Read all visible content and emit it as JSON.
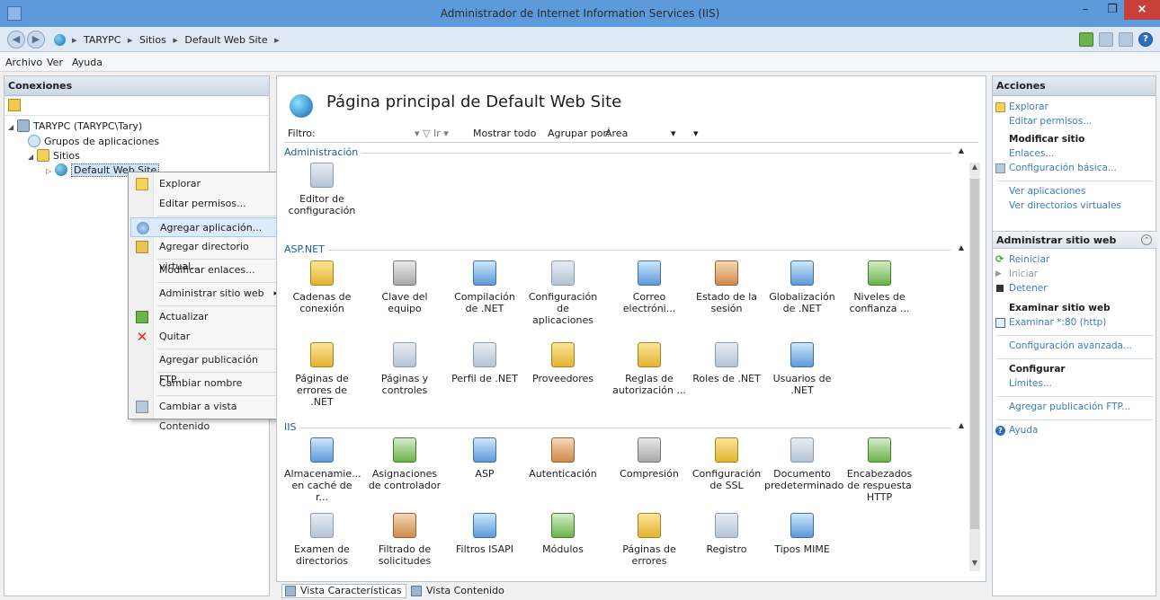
{
  "window": {
    "title": "Administrador de Internet Information Services (IIS)",
    "min": "–",
    "max": "❐",
    "close": "×"
  },
  "address": {
    "back": "◀",
    "forward": "▶",
    "crumbs": [
      "TARYPC",
      "Sitios",
      "Default Web Site"
    ],
    "sep": "▸"
  },
  "menu": [
    "Archivo",
    "Ver",
    "Ayuda"
  ],
  "connections": {
    "title": "Conexiones",
    "tree": [
      {
        "label": "TARYPC (TARYPC\\Tary)",
        "arrow": "◢"
      },
      {
        "label": "Grupos de aplicaciones",
        "arrow": ""
      },
      {
        "label": "Sitios",
        "arrow": "◢"
      },
      {
        "label": "Default Web Site",
        "arrow": "▷"
      }
    ]
  },
  "context_menu": {
    "items": [
      "Explorar",
      "Editar permisos...",
      "Agregar aplicación...",
      "Agregar directorio virtual...",
      "Modificar enlaces...",
      "Administrar sitio web",
      "Actualizar",
      "Quitar",
      "Agregar publicación FTP...",
      "Cambiar nombre",
      "Cambiar a vista Contenido"
    ],
    "submenu_arrow": "▸",
    "remove_glyph": "✕"
  },
  "main": {
    "title": "Página principal de Default Web Site",
    "filter_label": "Filtro:",
    "go_label": "▾ ▽ Ir ▾",
    "show_all": "Mostrar todo",
    "group_by_label": "Agrupar por:",
    "group_by_value": "Área",
    "dropdown_arrow": "▾",
    "collapse_glyph": "▲",
    "groups": [
      {
        "title": "Administración",
        "items": [
          "Editor de configuración"
        ]
      },
      {
        "title": "ASP.NET",
        "items": [
          "Cadenas de conexión",
          "Clave del equipo",
          "Compilación de .NET",
          "Configuración de aplicaciones",
          "Correo electróni...",
          "Estado de la sesión",
          "Globalización de .NET",
          "Niveles de confianza ...",
          "Páginas de errores de .NET",
          "Páginas y controles",
          "Perfil de .NET",
          "Proveedores",
          "Reglas de autorización ...",
          "Roles de .NET",
          "Usuarios de .NET"
        ]
      },
      {
        "title": "IIS",
        "items": [
          "Almacenamie... en caché de r...",
          "Asignaciones de controlador",
          "ASP",
          "Autenticación",
          "Compresión",
          "Configuración de SSL",
          "Documento predeterminado",
          "Encabezados de respuesta HTTP",
          "Examen de directorios",
          "Filtrado de solicitudes",
          "Filtros ISAPI",
          "Módulos",
          "Páginas de errores",
          "Registro",
          "Tipos MIME"
        ]
      }
    ],
    "tabs": [
      "Vista Características",
      "Vista Contenido"
    ]
  },
  "actions": {
    "title": "Acciones",
    "top": [
      {
        "label": "Explorar",
        "style": "link"
      },
      {
        "label": "Editar permisos...",
        "style": "link"
      },
      {
        "label": "Modificar sitio",
        "style": "bold"
      },
      {
        "label": "Enlaces...",
        "style": "link"
      },
      {
        "label": "Configuración básica...",
        "style": "link"
      },
      {
        "label": "Ver aplicaciones",
        "style": "link"
      },
      {
        "label": "Ver directorios virtuales",
        "style": "link"
      }
    ],
    "manage_title": "Administrar sitio web",
    "manage": [
      {
        "label": "Reiniciar",
        "style": "link"
      },
      {
        "label": "Iniciar",
        "style": "disabled"
      },
      {
        "label": "Detener",
        "style": "link"
      },
      {
        "label": "Examinar sitio web",
        "style": "bold"
      },
      {
        "label": "Examinar *:80 (http)",
        "style": "link"
      },
      {
        "label": "Configuración avanzada...",
        "style": "link"
      },
      {
        "label": "Configurar",
        "style": "bold"
      },
      {
        "label": "Límites...",
        "style": "link"
      },
      {
        "label": "Agregar publicación FTP...",
        "style": "link"
      },
      {
        "label": "Ayuda",
        "style": "link"
      }
    ],
    "collapse_glyph": "⌃"
  }
}
